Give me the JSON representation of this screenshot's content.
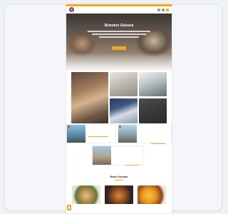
{
  "brand": {
    "logo_text": "",
    "accent": "#f2a81d",
    "brand_purple": "#6b3fa0"
  },
  "hero": {
    "kicker": "",
    "title": "Brandon Gaisura",
    "cta_label": ""
  },
  "features": [
    {
      "caption": ""
    },
    {
      "caption": ""
    },
    {
      "caption": ""
    },
    {
      "caption": ""
    },
    {
      "caption": ""
    }
  ],
  "locations": [
    {
      "name": ""
    },
    {
      "name": ""
    },
    {
      "name": ""
    }
  ],
  "section": {
    "title": "Brand Concepts"
  },
  "food_cards": [
    {
      "label": ""
    },
    {
      "label": ""
    },
    {
      "label": ""
    }
  ],
  "icons": [
    "logo-icon",
    "menu-icon",
    "side-tab-icon"
  ]
}
